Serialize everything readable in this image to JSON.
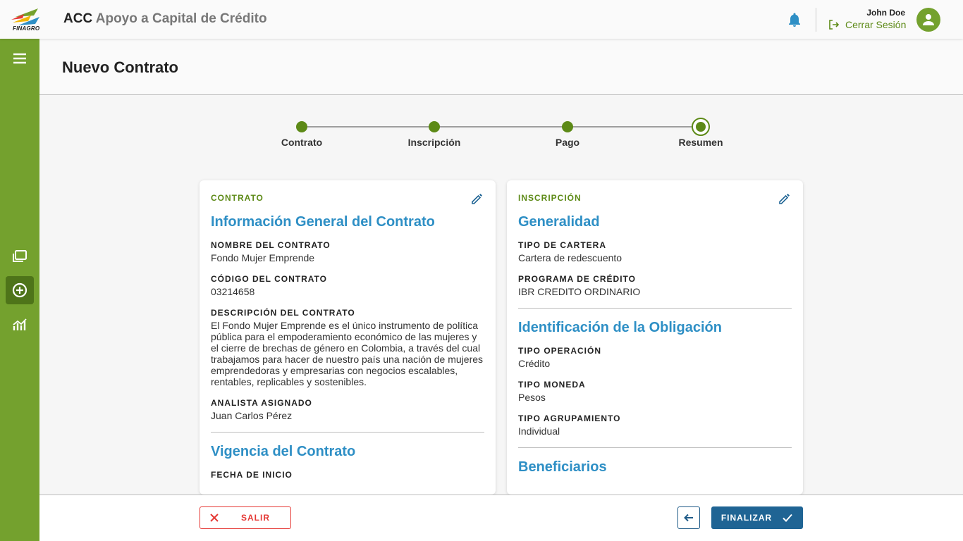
{
  "header": {
    "logo_text": "FINAGRO",
    "app_code": "ACC",
    "app_name": "Apoyo a Capital de Crédito",
    "user_name": "John Doe",
    "logout_label": "Cerrar Sesión"
  },
  "sidebar": {
    "items": [
      {
        "icon": "menu-icon",
        "active": false
      },
      {
        "icon": "folders-icon",
        "active": false
      },
      {
        "icon": "add-circle-icon",
        "active": true
      },
      {
        "icon": "chart-icon",
        "active": false
      }
    ]
  },
  "page": {
    "title": "Nuevo Contrato"
  },
  "stepper": {
    "steps": [
      {
        "label": "Contrato",
        "state": "done"
      },
      {
        "label": "Inscripción",
        "state": "done"
      },
      {
        "label": "Pago",
        "state": "done"
      },
      {
        "label": "Resumen",
        "state": "current"
      }
    ]
  },
  "contrato_card": {
    "tag": "CONTRATO",
    "section1_title": "Información General del Contrato",
    "fields": [
      {
        "label": "NOMBRE DEL CONTRATO",
        "value": "Fondo Mujer Emprende"
      },
      {
        "label": "CÓDIGO DEL CONTRATO",
        "value": "03214658"
      },
      {
        "label": "DESCRIPCIÓN DEL CONTRATO",
        "value": "El Fondo Mujer Emprende es el único instrumento de política pública para el empoderamiento económico de las mujeres y el cierre de brechas de género en Colombia, a través del cual trabajamos para hacer de nuestro país una nación de mujeres emprendedoras y empresarias con negocios escalables, rentables, replicables y sostenibles."
      },
      {
        "label": "ANALISTA ASIGNADO",
        "value": "Juan Carlos Pérez"
      }
    ],
    "section2_title": "Vigencia del Contrato",
    "section2_field_label": "FECHA DE INICIO"
  },
  "inscripcion_card": {
    "tag": "INSCRIPCIÓN",
    "section1_title": "Generalidad",
    "section1_fields": [
      {
        "label": "TIPO DE CARTERA",
        "value": "Cartera de redescuento"
      },
      {
        "label": "PROGRAMA DE CRÉDITO",
        "value": "IBR CREDITO ORDINARIO"
      }
    ],
    "section2_title": "Identificación de la Obligación",
    "section2_fields": [
      {
        "label": "TIPO OPERACIÓN",
        "value": "Crédito"
      },
      {
        "label": "TIPO MONEDA",
        "value": "Pesos"
      },
      {
        "label": "TIPO AGRUPAMIENTO",
        "value": "Individual"
      }
    ],
    "section3_title": "Beneficiarios"
  },
  "footer": {
    "exit_label": "SALIR",
    "finish_label": "FINALIZAR"
  },
  "colors": {
    "brand_green": "#74a12e",
    "accent_green": "#5d8a17",
    "title_blue": "#2e8fc5",
    "primary_button": "#1f6494",
    "danger": "#e53935"
  }
}
